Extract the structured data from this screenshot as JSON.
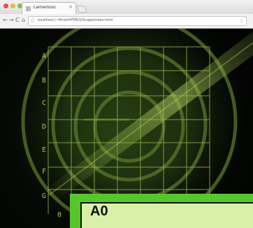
{
  "browser": {
    "tab": {
      "title": "Lamemosc",
      "close_icon": "close-icon",
      "favicon": "page-icon"
    },
    "address_bar": {
      "url": "localhost:/~finish/HTML5/Scope/index.html",
      "lock_icon": "page-icon",
      "bookmark_icon": "star-icon"
    },
    "navigation": {
      "back_icon": "back-icon",
      "forward_icon": "forward-icon",
      "reload_icon": "reload-icon",
      "home_icon": "home-icon"
    },
    "window_controls": [
      "close",
      "minimize",
      "maximize"
    ]
  },
  "radar": {
    "row_labels": [
      "A",
      "B",
      "C",
      "D",
      "E",
      "F",
      "G"
    ],
    "column_labels": [
      "0"
    ],
    "colors": {
      "grid": "#8ea43f",
      "sweep": "#6d8d2a",
      "ring": "#4b6724",
      "label": "#a8c64a"
    }
  },
  "panel": {
    "title": "A0",
    "colors": {
      "outer": "#55c72b",
      "inner": "#d8f0a8",
      "border": "#101010"
    }
  }
}
